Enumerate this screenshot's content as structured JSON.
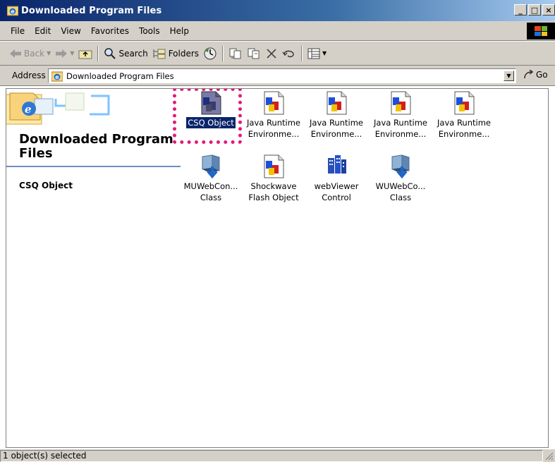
{
  "window": {
    "title": "Downloaded Program Files",
    "controls": [
      "minimize",
      "maximize",
      "close"
    ]
  },
  "menu": [
    "File",
    "Edit",
    "View",
    "Favorites",
    "Tools",
    "Help"
  ],
  "toolbar": {
    "back": "Back",
    "search": "Search",
    "folders": "Folders"
  },
  "address": {
    "label": "Address",
    "value": "Downloaded Program Files",
    "go": "Go"
  },
  "left_pane": {
    "folder_title": "Downloaded Program Files",
    "selected_item": "CSQ Object"
  },
  "items": [
    {
      "label": "CSQ Object",
      "icon": "activex-object-icon",
      "selected": true
    },
    {
      "label": "Java Runtime\nEnvironme...",
      "icon": "activex-object-icon"
    },
    {
      "label": "Java Runtime\nEnvironme...",
      "icon": "activex-object-icon"
    },
    {
      "label": "Java Runtime\nEnvironme...",
      "icon": "activex-object-icon"
    },
    {
      "label": "Java Runtime\nEnvironme...",
      "icon": "activex-object-icon"
    },
    {
      "label": "MUWebCon...\nClass",
      "icon": "windows-update-icon"
    },
    {
      "label": "Shockwave\nFlash Object",
      "icon": "activex-object-icon"
    },
    {
      "label": "webViewer\nControl",
      "icon": "buildings-icon"
    },
    {
      "label": "WUWebCo...\nClass",
      "icon": "windows-update-icon"
    }
  ],
  "status": {
    "text": "1 object(s) selected"
  },
  "colors": {
    "titlebar": "#0a246a",
    "selection": "#0a246a",
    "highlight_ring": "#e3197c",
    "chrome": "#d4d0c8"
  }
}
